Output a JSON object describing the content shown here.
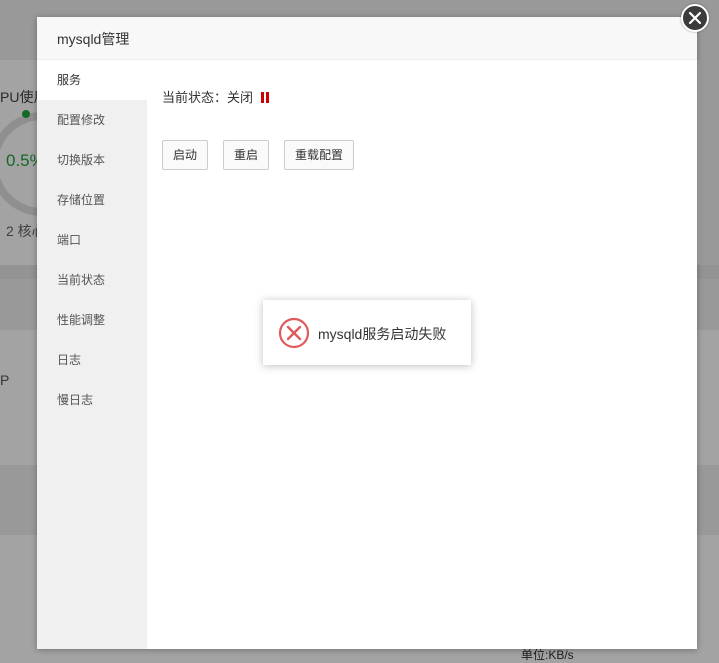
{
  "background": {
    "cpu_label": "PU使用",
    "cpu_value": "0.5%",
    "cores": "2 核心",
    "p_label": "P",
    "unit_label": "单位:KB/s"
  },
  "modal": {
    "title": "mysqld管理",
    "sidebar": [
      {
        "label": "服务",
        "active": true
      },
      {
        "label": "配置修改",
        "active": false
      },
      {
        "label": "切换版本",
        "active": false
      },
      {
        "label": "存储位置",
        "active": false
      },
      {
        "label": "端口",
        "active": false
      },
      {
        "label": "当前状态",
        "active": false
      },
      {
        "label": "性能调整",
        "active": false
      },
      {
        "label": "日志",
        "active": false
      },
      {
        "label": "慢日志",
        "active": false
      }
    ],
    "status": {
      "label": "当前状态：",
      "value": "关闭",
      "icon": "pause-icon",
      "color": "#cc0000"
    },
    "buttons": {
      "start": "启动",
      "restart": "重启",
      "reload": "重载配置"
    },
    "close_icon": "close-icon"
  },
  "message": {
    "text": "mysqld服务启动失败",
    "icon": "error-circle-icon",
    "icon_color": "#e05b5b"
  }
}
